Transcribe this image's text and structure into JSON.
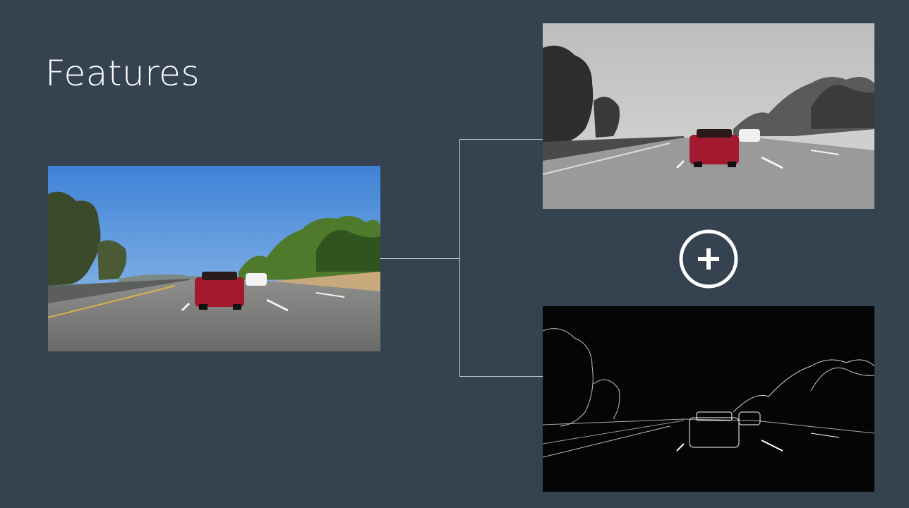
{
  "slide": {
    "title": "Features",
    "background_color": "#34434f",
    "text_color": "#ffffff",
    "connector_color": "#c5ccd2"
  },
  "images": {
    "original": {
      "description_name": "color-road-photo"
    },
    "grayscale": {
      "description_name": "grayscale-road-photo"
    },
    "edges": {
      "description_name": "edge-detection-road-photo"
    }
  },
  "operator": {
    "icon": "plus-circle-icon",
    "symbol": "+"
  }
}
